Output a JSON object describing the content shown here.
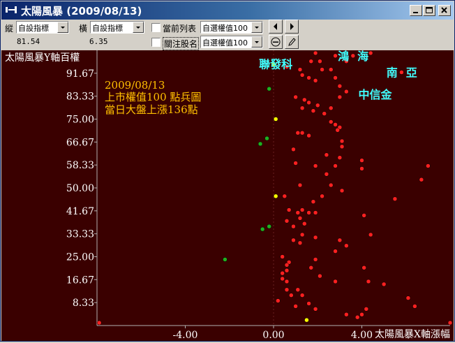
{
  "window": {
    "title": "太陽風暴 (2009/08/13)"
  },
  "toolbar": {
    "vertical_label": "縱",
    "vertical_select": "自設指標",
    "vertical_value": "81.54",
    "horizontal_label": "橫",
    "horizontal_select": "自設指標",
    "horizontal_value": "6.35",
    "current_list_label": "當前列表",
    "current_list_select": "自選權值100",
    "watch_stocks_label": "關注股名",
    "watch_stocks_select": "自選權值100"
  },
  "colors": {
    "background": "#3a0000",
    "dot_red": "#ff2020",
    "dot_yellow": "#ffff00",
    "dot_green": "#20b020",
    "annotation": "#ffc000",
    "stock_label": "#40ffff"
  },
  "chart_data": {
    "type": "scatter",
    "ylabel": "太陽風暴Y軸百權",
    "xlabel": "太陽風暴X軸漲幅",
    "annotation_lines": [
      "2009/08/13",
      "上市權值100 點兵圖",
      "當日大盤上漲136點"
    ],
    "y_ticks": [
      "91.67",
      "83.33",
      "75.00",
      "66.67",
      "58.33",
      "50.00",
      "41.67",
      "33.33",
      "25.00",
      "16.67",
      "8.33"
    ],
    "x_ticks": [
      "-4.00",
      "0.00",
      "4.00"
    ],
    "xlim": [
      -8.0,
      8.0
    ],
    "ylim": [
      0,
      100
    ],
    "stock_labels": [
      {
        "name": "聯發科",
        "x": 0.1,
        "y": 95
      },
      {
        "name": "鴻海",
        "x": 3.8,
        "y": 98
      },
      {
        "name": "南亞",
        "x": 6.0,
        "y": 92
      },
      {
        "name": "中信金",
        "x": 4.6,
        "y": 84
      }
    ],
    "series": [
      {
        "color": "red",
        "points": [
          [
            1.9,
            99
          ],
          [
            2.8,
            98
          ],
          [
            3.6,
            98
          ],
          [
            4.4,
            99
          ],
          [
            1.7,
            96
          ],
          [
            2.1,
            96
          ],
          [
            3.3,
            96
          ],
          [
            0.6,
            94
          ],
          [
            1.2,
            93
          ],
          [
            2.2,
            93
          ],
          [
            2.6,
            93
          ],
          [
            5.8,
            92
          ],
          [
            1.3,
            91
          ],
          [
            1.6,
            90
          ],
          [
            1.9,
            89
          ],
          [
            2.8,
            90
          ],
          [
            3.0,
            87
          ],
          [
            3.3,
            85
          ],
          [
            3.0,
            83
          ],
          [
            1.0,
            83
          ],
          [
            1.4,
            82
          ],
          [
            1.6,
            81
          ],
          [
            2.0,
            80
          ],
          [
            1.3,
            79
          ],
          [
            2.6,
            79
          ],
          [
            1.8,
            78
          ],
          [
            2.3,
            77
          ],
          [
            2.6,
            74
          ],
          [
            2.8,
            73
          ],
          [
            3.0,
            72
          ],
          [
            2.9,
            71
          ],
          [
            1.1,
            70
          ],
          [
            1.3,
            70
          ],
          [
            1.6,
            69
          ],
          [
            3.1,
            67
          ],
          [
            3.1,
            65
          ],
          [
            0.9,
            64
          ],
          [
            2.4,
            62
          ],
          [
            3.0,
            61
          ],
          [
            4.0,
            60
          ],
          [
            1.0,
            59
          ],
          [
            1.9,
            58
          ],
          [
            2.8,
            58
          ],
          [
            4.0,
            57
          ],
          [
            7.0,
            58
          ],
          [
            2.4,
            55
          ],
          [
            6.7,
            53
          ],
          [
            1.2,
            51
          ],
          [
            2.6,
            51
          ],
          [
            3.1,
            49
          ],
          [
            0.5,
            47
          ],
          [
            2.2,
            47
          ],
          [
            5.5,
            46
          ],
          [
            1.8,
            45
          ],
          [
            0.7,
            42
          ],
          [
            1.3,
            42
          ],
          [
            1.1,
            41
          ],
          [
            1.6,
            41
          ],
          [
            1.9,
            41
          ],
          [
            4.1,
            40
          ],
          [
            1.2,
            39
          ],
          [
            0.6,
            38
          ],
          [
            1.4,
            37
          ],
          [
            0.9,
            36
          ],
          [
            1.3,
            33
          ],
          [
            1.9,
            32
          ],
          [
            4.4,
            33
          ],
          [
            0.9,
            31
          ],
          [
            1.2,
            30
          ],
          [
            3.0,
            31
          ],
          [
            3.3,
            29
          ],
          [
            2.8,
            27
          ],
          [
            0.4,
            25
          ],
          [
            0.7,
            23
          ],
          [
            1.9,
            24
          ],
          [
            0.6,
            22
          ],
          [
            0.6,
            20
          ],
          [
            1.7,
            21
          ],
          [
            0.4,
            19
          ],
          [
            4.1,
            21
          ],
          [
            0.4,
            17
          ],
          [
            2.1,
            18
          ],
          [
            4.3,
            16
          ],
          [
            0.6,
            16
          ],
          [
            2.8,
            16
          ],
          [
            5.0,
            15
          ],
          [
            0.6,
            13
          ],
          [
            1.1,
            13
          ],
          [
            0.8,
            11
          ],
          [
            1.3,
            11
          ],
          [
            0.2,
            9
          ],
          [
            1.6,
            8
          ],
          [
            6.1,
            10
          ],
          [
            1.0,
            7
          ],
          [
            1.9,
            6
          ],
          [
            3.3,
            4
          ],
          [
            4.2,
            6
          ],
          [
            4.0,
            4
          ],
          [
            3.8,
            3
          ],
          [
            6.4,
            7
          ],
          [
            8.0,
            1
          ],
          [
            -7.9,
            1
          ]
        ]
      },
      {
        "color": "yellow",
        "points": [
          [
            0.0,
            95
          ],
          [
            0.1,
            75
          ],
          [
            0.1,
            47
          ],
          [
            1.5,
            2
          ]
        ]
      },
      {
        "color": "green",
        "points": [
          [
            -0.2,
            86
          ],
          [
            -0.3,
            68
          ],
          [
            -0.6,
            66
          ],
          [
            -0.5,
            35
          ],
          [
            -0.2,
            36
          ],
          [
            -2.2,
            24
          ]
        ]
      }
    ]
  }
}
